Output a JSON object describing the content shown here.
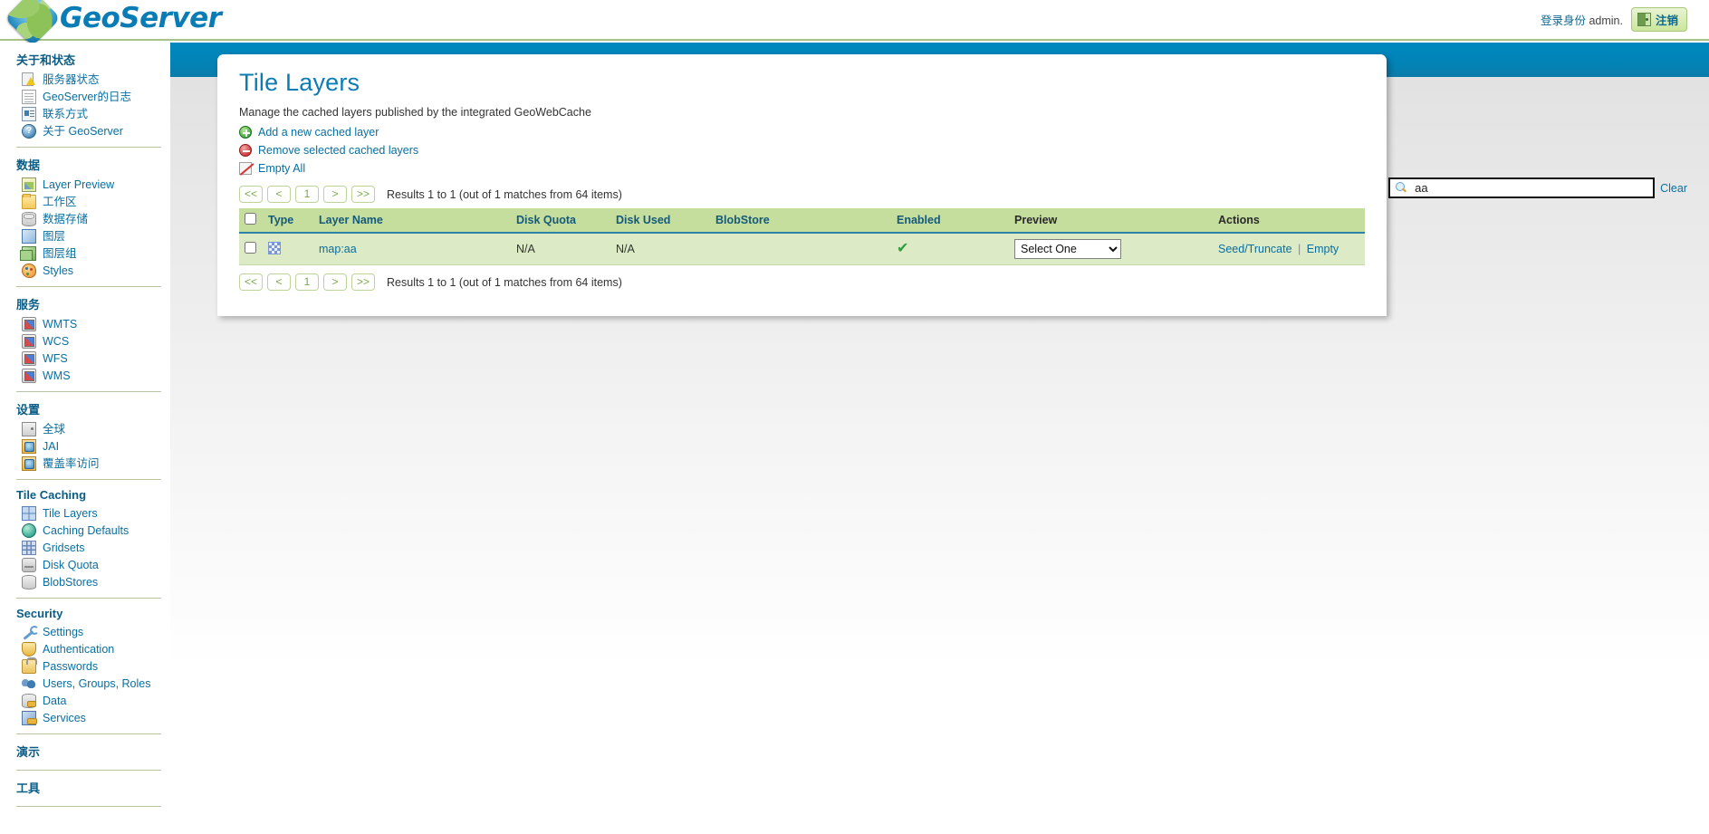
{
  "header": {
    "brand": "GeoServer",
    "logged_in_prefix": "登录身份",
    "logged_in_user": "admin.",
    "logout_label": "注销"
  },
  "sidebar": {
    "sections": [
      {
        "title": "关于和状态",
        "items": [
          {
            "label": "服务器状态",
            "icon": "server-status-icon"
          },
          {
            "label": "GeoServer的日志",
            "icon": "log-page-icon"
          },
          {
            "label": "联系方式",
            "icon": "contact-card-icon"
          },
          {
            "label": "关于 GeoServer",
            "icon": "about-info-icon"
          }
        ]
      },
      {
        "title": "数据",
        "items": [
          {
            "label": "Layer Preview",
            "icon": "layer-preview-icon"
          },
          {
            "label": "工作区",
            "icon": "workspace-folder-icon"
          },
          {
            "label": "数据存储",
            "icon": "datastore-database-icon"
          },
          {
            "label": "图层",
            "icon": "layer-square-icon"
          },
          {
            "label": "图层组",
            "icon": "layergroup-stack-icon"
          },
          {
            "label": "Styles",
            "icon": "styles-palette-icon"
          }
        ]
      },
      {
        "title": "服务",
        "items": [
          {
            "label": "WMTS",
            "icon": "service-wmts-icon"
          },
          {
            "label": "WCS",
            "icon": "service-wcs-icon"
          },
          {
            "label": "WFS",
            "icon": "service-wfs-icon"
          },
          {
            "label": "WMS",
            "icon": "service-wms-icon"
          }
        ]
      },
      {
        "title": "设置",
        "items": [
          {
            "label": "全球",
            "icon": "global-settings-icon"
          },
          {
            "label": "JAI",
            "icon": "jai-settings-icon"
          },
          {
            "label": "覆盖率访问",
            "icon": "coverage-access-icon"
          }
        ]
      },
      {
        "title": "Tile Caching",
        "items": [
          {
            "label": "Tile Layers",
            "icon": "tile-layers-icon"
          },
          {
            "label": "Caching Defaults",
            "icon": "caching-defaults-icon"
          },
          {
            "label": "Gridsets",
            "icon": "gridsets-icon"
          },
          {
            "label": "Disk Quota",
            "icon": "disk-quota-icon"
          },
          {
            "label": "BlobStores",
            "icon": "blobstores-icon"
          }
        ]
      },
      {
        "title": "Security",
        "items": [
          {
            "label": "Settings",
            "icon": "security-settings-wrench-icon"
          },
          {
            "label": "Authentication",
            "icon": "authentication-shield-icon"
          },
          {
            "label": "Passwords",
            "icon": "passwords-lock-icon"
          },
          {
            "label": "Users, Groups, Roles",
            "icon": "users-groups-roles-icon"
          },
          {
            "label": "Data",
            "icon": "data-security-icon"
          },
          {
            "label": "Services",
            "icon": "services-security-icon"
          }
        ]
      },
      {
        "title": "演示",
        "items": []
      },
      {
        "title": "工具",
        "items": []
      }
    ]
  },
  "main": {
    "title": "Tile Layers",
    "description": "Manage the cached layers published by the integrated GeoWebCache",
    "actions": [
      {
        "label": "Add a new cached layer",
        "icon": "add-circle-icon"
      },
      {
        "label": "Remove selected cached layers",
        "icon": "remove-circle-icon"
      },
      {
        "label": "Empty All",
        "icon": "empty-all-icon"
      }
    ],
    "pager": {
      "first": "<<",
      "prev": "<",
      "page": "1",
      "next": ">",
      "last": ">>",
      "results_text": "Results 1 to 1 (out of 1 matches from 64 items)"
    },
    "search": {
      "value": "aa",
      "placeholder": "",
      "clear_label": "Clear"
    },
    "table": {
      "columns": [
        {
          "label": "Type",
          "sortable": true
        },
        {
          "label": "Layer Name",
          "sortable": true
        },
        {
          "label": "Disk Quota",
          "sortable": true
        },
        {
          "label": "Disk Used",
          "sortable": true
        },
        {
          "label": "BlobStore",
          "sortable": true
        },
        {
          "label": "Enabled",
          "sortable": true
        },
        {
          "label": "Preview",
          "sortable": false
        },
        {
          "label": "Actions",
          "sortable": false
        }
      ],
      "rows": [
        {
          "type_icon": "raster-tile-icon",
          "layer_name": "map:aa",
          "disk_quota": "N/A",
          "disk_used": "N/A",
          "blobstore": "",
          "enabled": "✔",
          "preview_selected": "Select One",
          "preview_options": [
            "Select One"
          ],
          "action_seed": "Seed/Truncate",
          "action_sep": "|",
          "action_empty": "Empty"
        }
      ]
    }
  },
  "colors": {
    "brand_blue": "#0a7cb5",
    "band_blue": "#0089bf",
    "link_blue": "#0b6e9e",
    "header_green": "#c5dd9d",
    "row_green": "#dcebc5",
    "accent_green": "#a8c186"
  }
}
